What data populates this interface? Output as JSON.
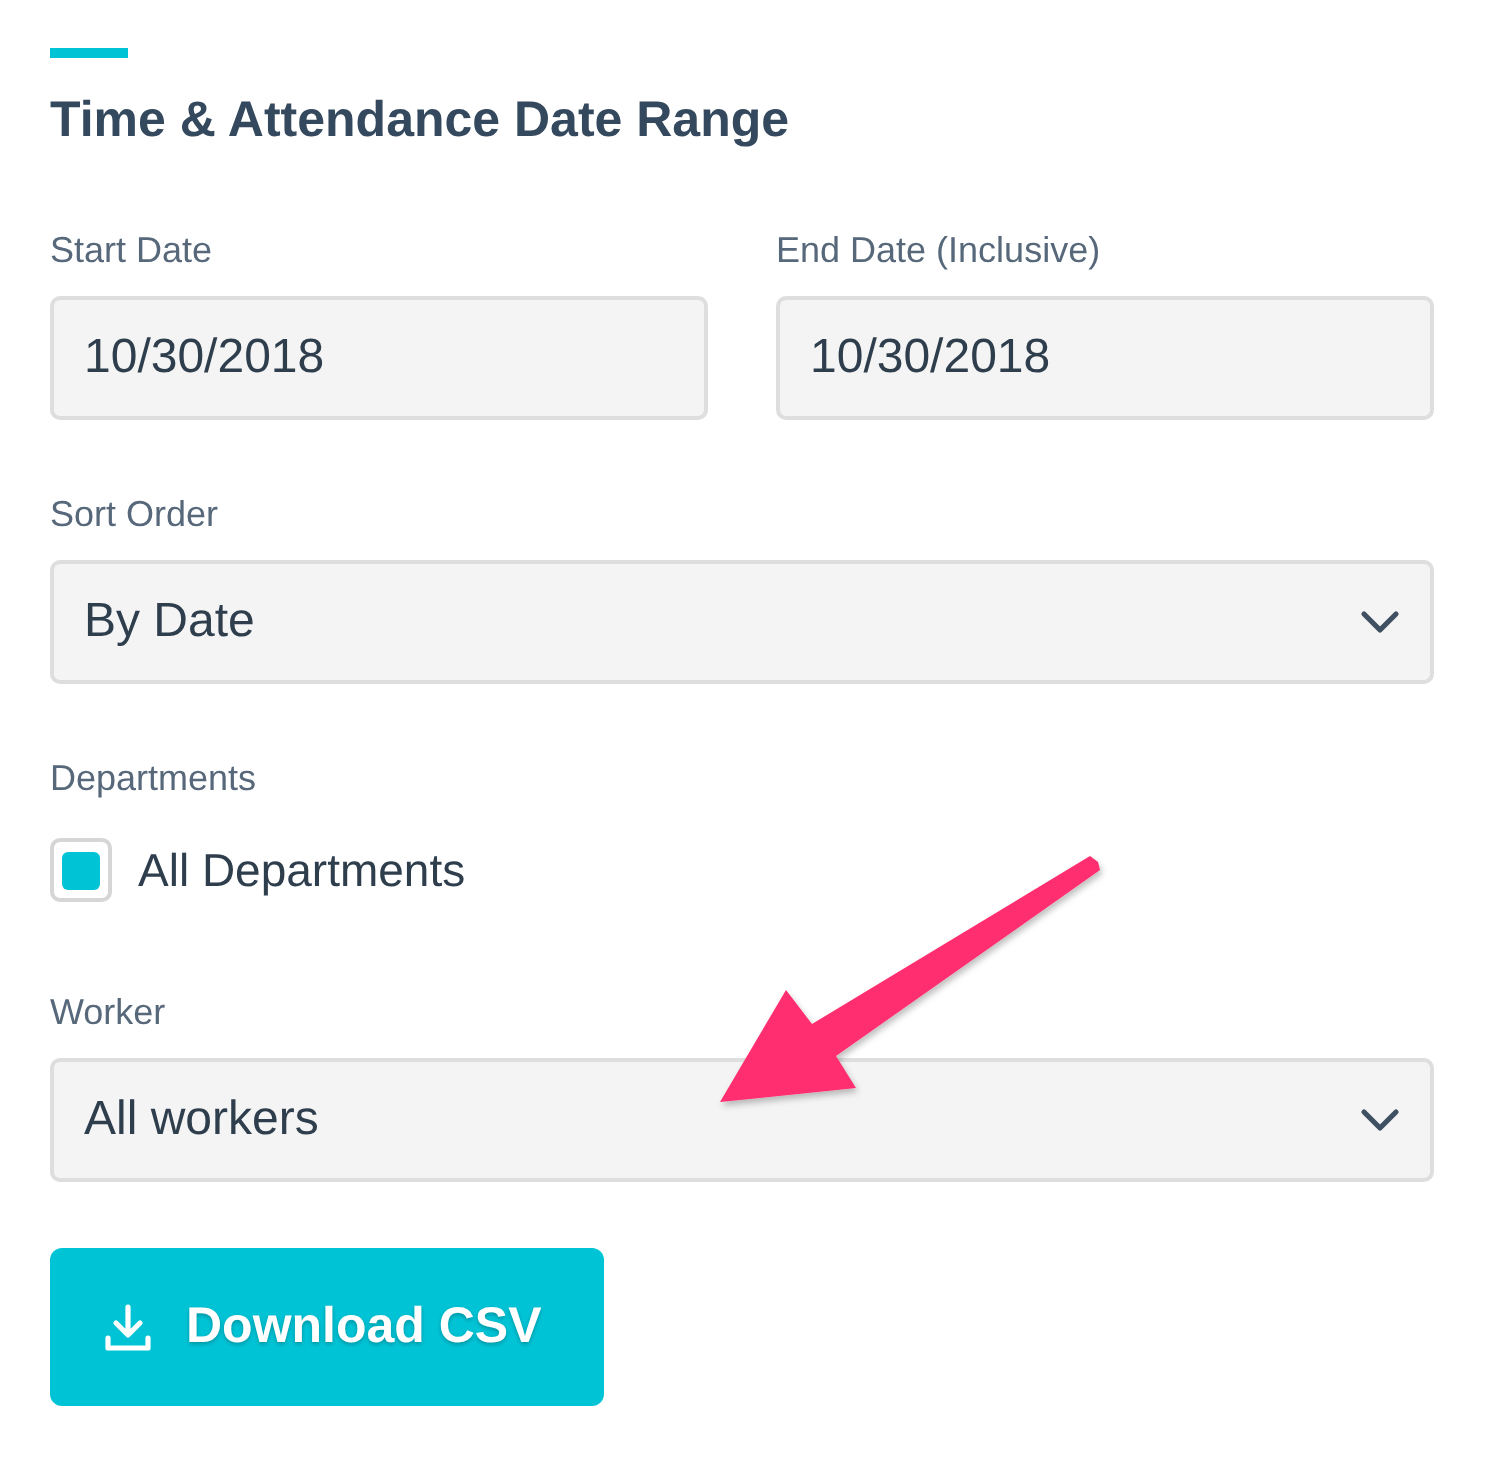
{
  "section": {
    "title": "Time & Attendance Date Range"
  },
  "date_range": [
    {
      "label": "Start Date",
      "value": "10/30/2018"
    },
    {
      "label": "End Date (Inclusive)",
      "value": "10/30/2018"
    }
  ],
  "sort_order": {
    "label": "Sort Order",
    "value": "By Date"
  },
  "departments": {
    "label": "Departments",
    "options": [
      {
        "label": "All Departments",
        "checked": true
      }
    ]
  },
  "worker": {
    "label": "Worker",
    "value": "All workers"
  },
  "button": {
    "label": "Download CSV"
  },
  "annotation": {
    "kind": "arrow"
  }
}
